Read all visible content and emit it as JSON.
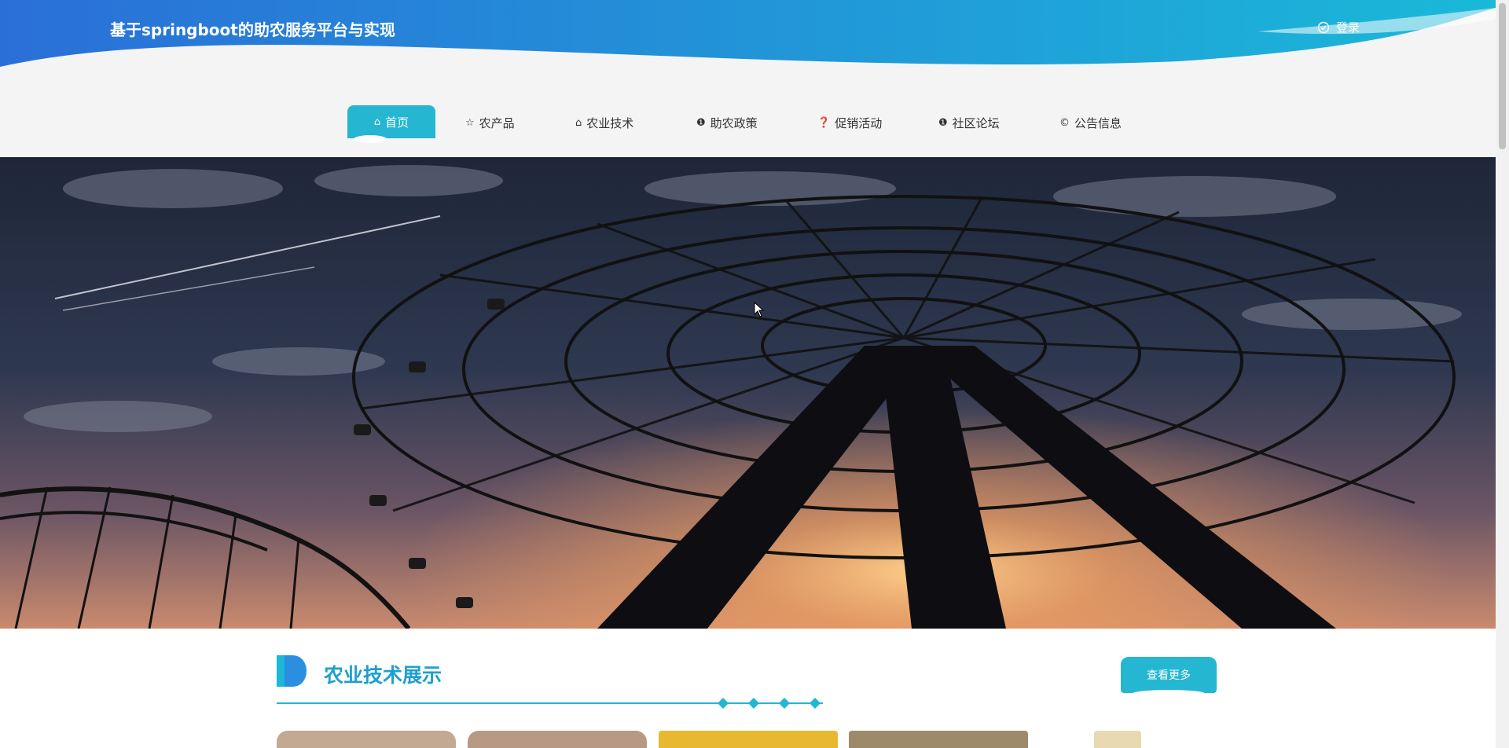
{
  "header": {
    "site_title": "基于springboot的助农服务平台与实现",
    "login_label": "登录"
  },
  "nav": {
    "items": [
      {
        "label": "首页",
        "icon": "home-icon",
        "glyph": "⌂"
      },
      {
        "label": "农产品",
        "icon": "star-icon",
        "glyph": "☆"
      },
      {
        "label": "农业技术",
        "icon": "home-icon",
        "glyph": "⌂"
      },
      {
        "label": "助农政策",
        "icon": "info-icon",
        "glyph": "❶"
      },
      {
        "label": "促销活动",
        "icon": "question-icon",
        "glyph": "❓"
      },
      {
        "label": "社区论坛",
        "icon": "info-icon",
        "glyph": "❶"
      },
      {
        "label": "公告信息",
        "icon": "copyright-icon",
        "glyph": "©"
      }
    ]
  },
  "banner": {
    "description_icon": "ferris-wheel-image"
  },
  "section": {
    "title": "农业技术展示",
    "more_label": "查看更多"
  },
  "colors": {
    "accent": "#25b6d2",
    "title_blue": "#1e9fd0",
    "header_start": "#2a73d9",
    "header_end": "#1bb8d8"
  }
}
